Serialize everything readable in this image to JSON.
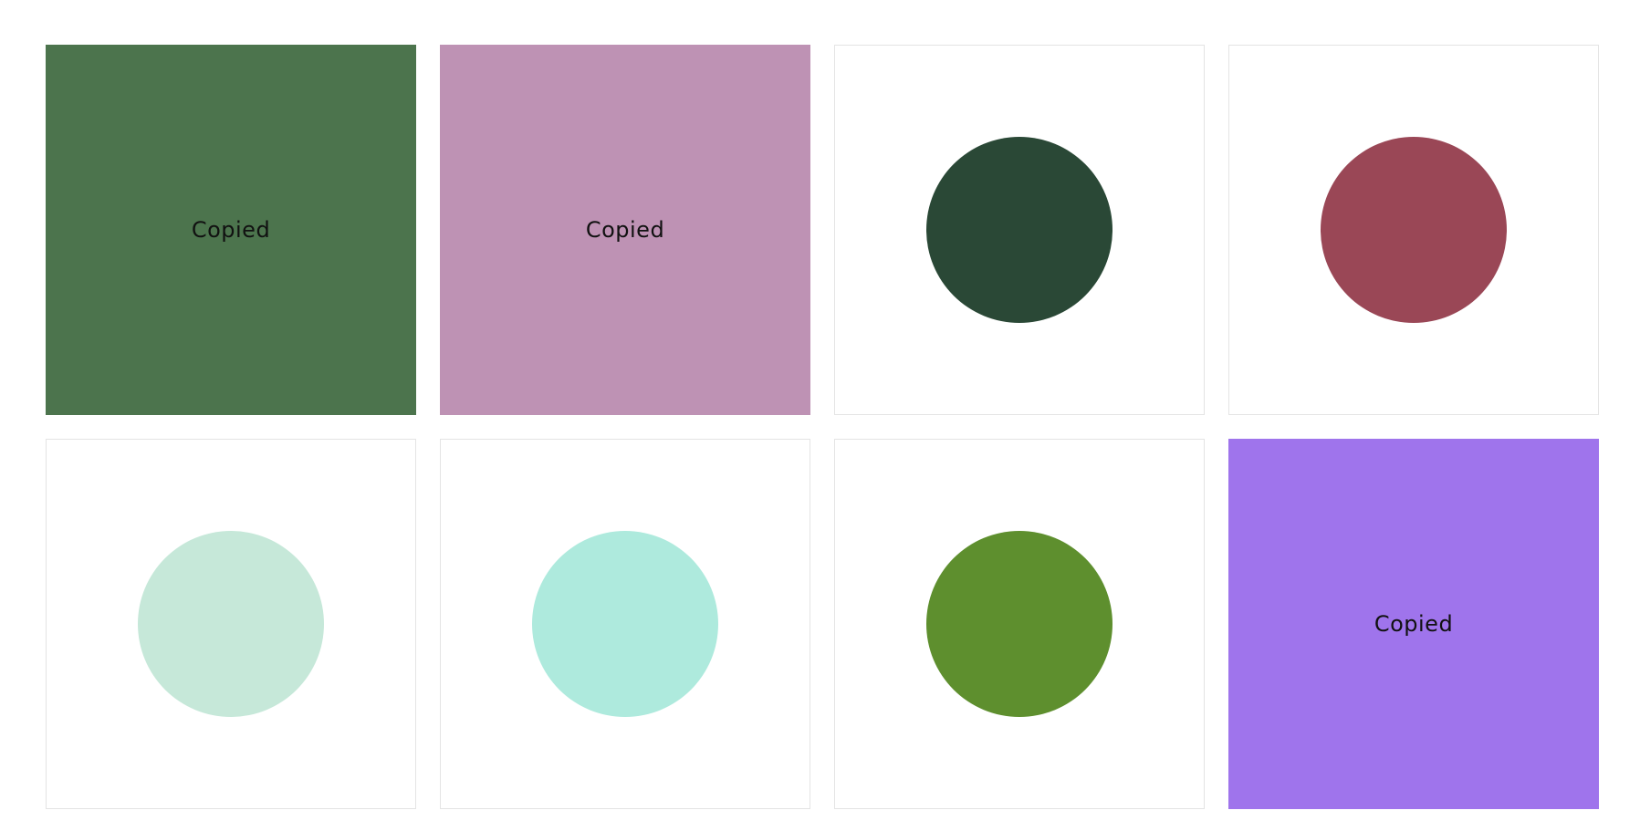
{
  "swatches": [
    {
      "color": "#4c744d",
      "state": "copied",
      "label": "Copied"
    },
    {
      "color": "#be92b4",
      "state": "copied",
      "label": "Copied"
    },
    {
      "color": "#2a4836",
      "state": "idle"
    },
    {
      "color": "#9a4756",
      "state": "idle"
    },
    {
      "color": "#c6e8d9",
      "state": "idle"
    },
    {
      "color": "#aeeadd",
      "state": "idle"
    },
    {
      "color": "#5e8f2e",
      "state": "idle"
    },
    {
      "color": "#9f74ec",
      "state": "copied",
      "label": "Copied"
    }
  ]
}
